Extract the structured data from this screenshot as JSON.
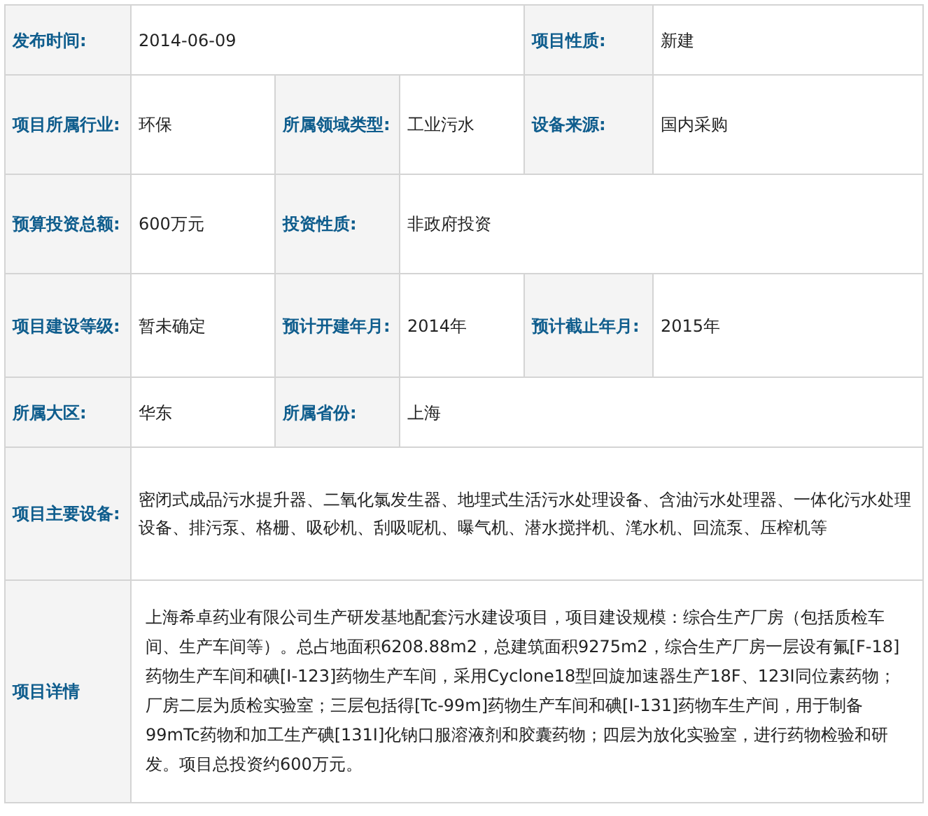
{
  "rows": [
    {
      "cells": [
        {
          "kind": "label",
          "text": "发布时间:"
        },
        {
          "kind": "value",
          "text": "2014-06-09",
          "wide": true
        },
        {
          "kind": "label",
          "text": "项目性质:"
        },
        {
          "kind": "value",
          "text": "新建"
        }
      ]
    },
    {
      "cells": [
        {
          "kind": "label",
          "text": "项目所属行业:"
        },
        {
          "kind": "value",
          "text": "环保"
        },
        {
          "kind": "label",
          "text": "所属领域类型:"
        },
        {
          "kind": "value",
          "text": "工业污水"
        },
        {
          "kind": "label",
          "text": "设备来源:"
        },
        {
          "kind": "value",
          "text": "国内采购"
        }
      ]
    },
    {
      "cells": [
        {
          "kind": "label",
          "text": "预算投资总额:"
        },
        {
          "kind": "value",
          "text": "600万元"
        },
        {
          "kind": "label",
          "text": "投资性质:"
        },
        {
          "kind": "value",
          "text": "非政府投资",
          "wide": true
        }
      ]
    },
    {
      "cells": [
        {
          "kind": "label",
          "text": "项目建设等级:"
        },
        {
          "kind": "value",
          "text": "暂未确定"
        },
        {
          "kind": "label",
          "text": "预计开建年月:"
        },
        {
          "kind": "value",
          "text": "2014年"
        },
        {
          "kind": "label",
          "text": "预计截止年月:"
        },
        {
          "kind": "value",
          "text": "2015年"
        }
      ]
    },
    {
      "cells": [
        {
          "kind": "label",
          "text": "所属大区:"
        },
        {
          "kind": "value",
          "text": "华东"
        },
        {
          "kind": "label",
          "text": "所属省份:"
        },
        {
          "kind": "value",
          "text": "上海",
          "wide": true
        }
      ]
    },
    {
      "cells": [
        {
          "kind": "label",
          "text": "项目主要设备:"
        },
        {
          "kind": "value",
          "text": "密闭式成品污水提升器、二氧化氯发生器、地埋式生活污水处理设备、含油污水处理器、一体化污水处理设备、排污泵、格栅、吸砂机、刮吸呢机、曝气机、潜水搅拌机、滗水机、回流泵、压榨机等",
          "wide": true
        }
      ]
    },
    {
      "cells": [
        {
          "kind": "label",
          "text": "项目详情"
        },
        {
          "kind": "detail",
          "text": "上海希卓药业有限公司生产研发基地配套污水建设项目，项目建设规模：综合生产厂房（包括质检车间、生产车间等）。总占地面积6208.88m2，总建筑面积9275m2，综合生产厂房一层设有氟[F-18]药物生产车间和碘[I-123]药物生产车间，采用Cyclone18型回旋加速器生产18F、123I同位素药物；厂房二层为质检实验室；三层包括得[Tc-99m]药物生产车间和碘[I-131]药物车生产间，用于制备99mTc药物和加工生产碘[131I]化钠口服溶液剂和胶囊药物；四层为放化实验室，进行药物检验和研发。项目总投资约600万元。",
          "wide": true
        }
      ]
    }
  ]
}
